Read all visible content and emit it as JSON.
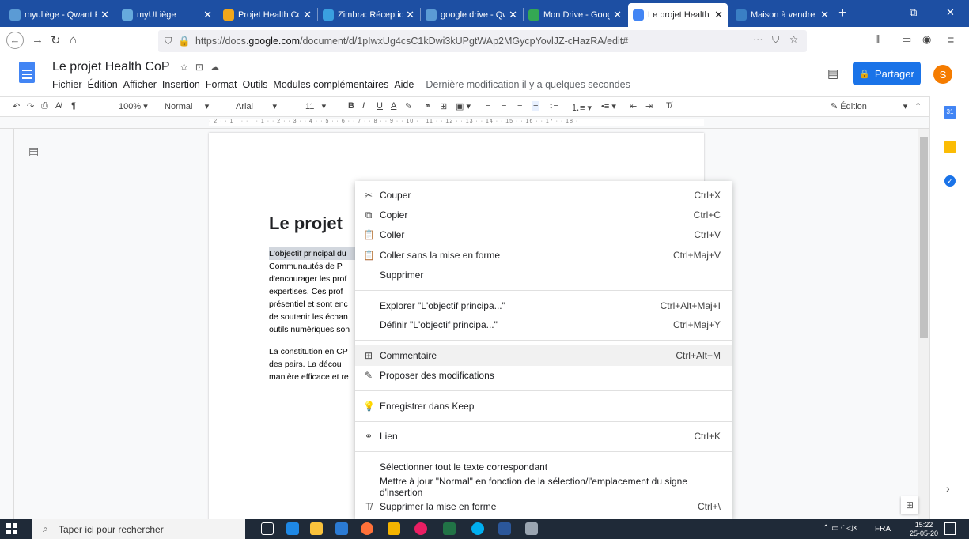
{
  "tabs": [
    {
      "label": "myuliège - Qwant F",
      "icon_color": "#5b9bd5"
    },
    {
      "label": "myULiège",
      "icon_color": "#6ad"
    },
    {
      "label": "Projet Health CoP",
      "icon_color": "#f2a71b"
    },
    {
      "label": "Zimbra: Réception (",
      "icon_color": "#3aa0e0"
    },
    {
      "label": "google drive - Qwa",
      "icon_color": "#5b9bd5"
    },
    {
      "label": "Mon Drive - Google",
      "icon_color": "#34a853"
    },
    {
      "label": "Le projet Health Co",
      "icon_color": "#4285f4"
    },
    {
      "label": "Maison à vendre - r",
      "icon_color": "#3a7fc4"
    }
  ],
  "browser": {
    "url_prefix": "https://docs.",
    "url_domain": "google.com",
    "url_rest": "/document/d/1pIwxUg4csC1kDwi3kUPgtWAp2MGycpYovlJZ-cHazRA/edit#"
  },
  "docs": {
    "title": "Le projet Health CoP",
    "menu": [
      "Fichier",
      "Édition",
      "Afficher",
      "Insertion",
      "Format",
      "Outils",
      "Modules complémentaires",
      "Aide"
    ],
    "last_edit": "Dernière modification il y a quelques secondes",
    "share_label": "Partager",
    "avatar_letter": "S",
    "accent": "#1a73e8"
  },
  "toolbar": {
    "zoom": "100%",
    "style": "Normal",
    "font": "Arial",
    "size": "11",
    "mode": "Édition"
  },
  "ruler": {
    "marks": "· 2 · · 1 · · · · · 1 · · 2 · · 3 · · 4 · · 5 · · 6 · · 7 · · 8 · · 9 · · 10 · · 11 · · 12 · · 13 · · 14 · · 15 · · 16 · · 17 · · 18 ·"
  },
  "document": {
    "heading": "Le projet",
    "para1": [
      "L'objectif principal du",
      "Communautés de P",
      "d'encourager les prof",
      "expertises. Ces prof",
      "présentiel et sont enc",
      "de soutenir les échan",
      "outils numériques son"
    ],
    "para2": [
      "La constitution en CP",
      "des pairs. La décou",
      "manière efficace et re"
    ]
  },
  "context_menu": {
    "items": [
      {
        "icon": "✂",
        "label": "Couper",
        "shortcut": "Ctrl+X"
      },
      {
        "icon": "⧉",
        "label": "Copier",
        "shortcut": "Ctrl+C"
      },
      {
        "icon": "📋",
        "label": "Coller",
        "shortcut": "Ctrl+V"
      },
      {
        "icon": "📋",
        "label": "Coller sans la mise en forme",
        "shortcut": "Ctrl+Maj+V"
      },
      {
        "icon": "",
        "label": "Supprimer",
        "shortcut": ""
      },
      {
        "icon": "",
        "label": "Explorer \"L'objectif principa...\"",
        "shortcut": "Ctrl+Alt+Maj+I"
      },
      {
        "icon": "",
        "label": "Définir \"L'objectif principa...\"",
        "shortcut": "Ctrl+Maj+Y"
      },
      {
        "icon": "⊞",
        "label": "Commentaire",
        "shortcut": "Ctrl+Alt+M"
      },
      {
        "icon": "✎",
        "label": "Proposer des modifications",
        "shortcut": ""
      },
      {
        "icon": "💡",
        "label": "Enregistrer dans Keep",
        "shortcut": ""
      },
      {
        "icon": "⚭",
        "label": "Lien",
        "shortcut": "Ctrl+K"
      },
      {
        "icon": "",
        "label": "Sélectionner tout le texte correspondant",
        "shortcut": ""
      },
      {
        "icon": "",
        "label": "Mettre à jour \"Normal\" en fonction de la sélection/l'emplacement du signe d'insertion",
        "shortcut": ""
      },
      {
        "icon": "T̸",
        "label": "Supprimer la mise en forme",
        "shortcut": "Ctrl+\\"
      }
    ]
  },
  "taskbar": {
    "search_placeholder": "Taper ici pour rechercher",
    "lang": "FRA",
    "time": "15:22",
    "date": "25-05-20"
  }
}
